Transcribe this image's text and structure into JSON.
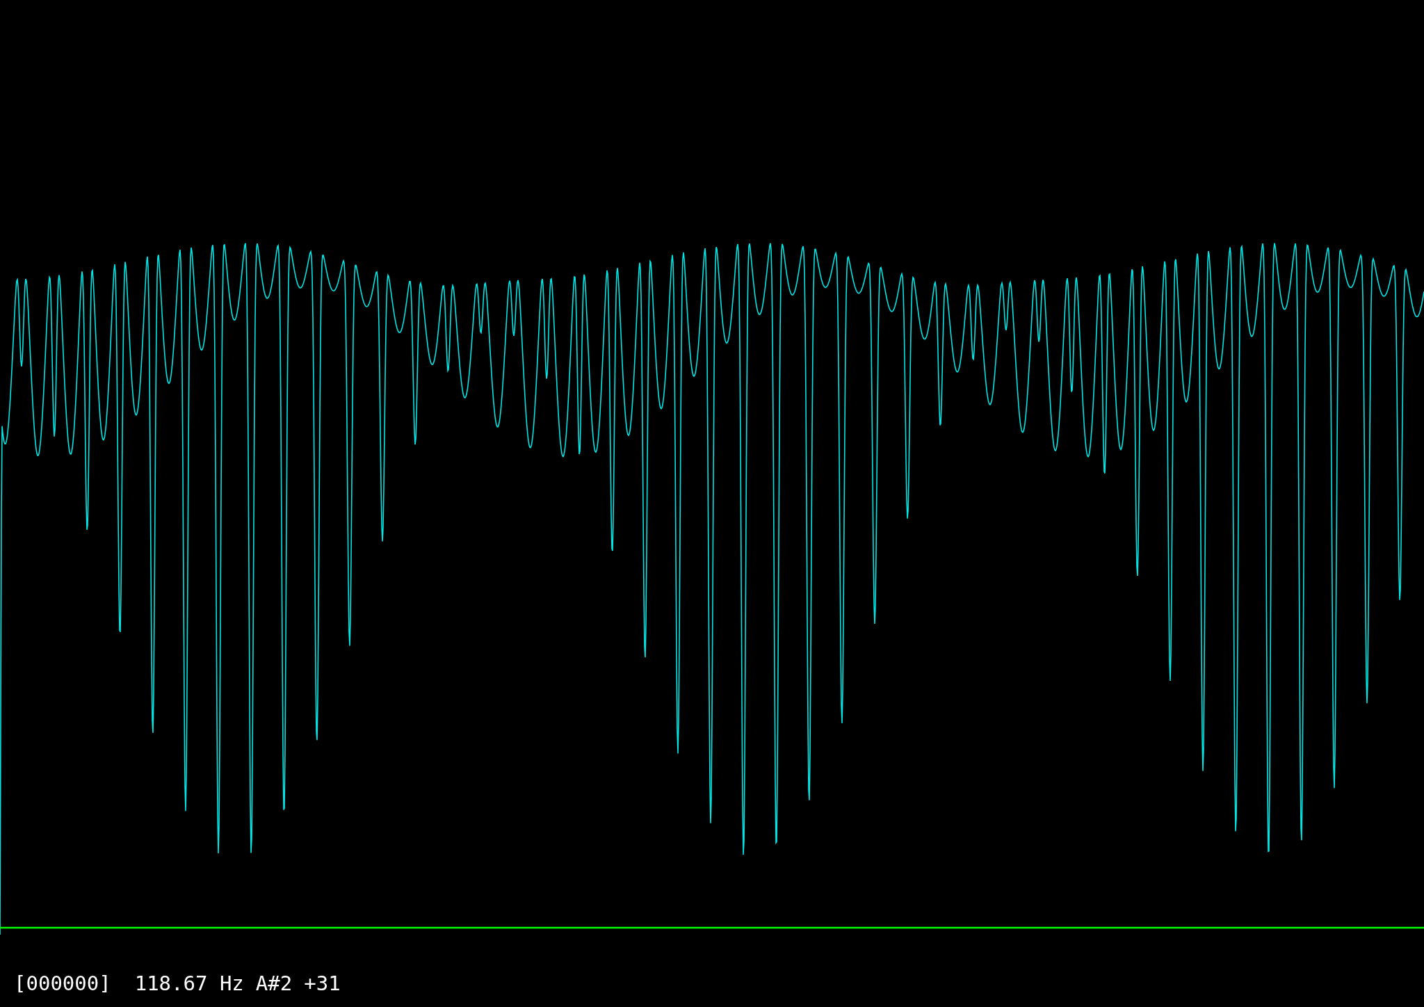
{
  "status_bar": {
    "frame": "[000000]",
    "frequency": "118.67 Hz",
    "note": "A#2",
    "cents": "+31"
  }
}
